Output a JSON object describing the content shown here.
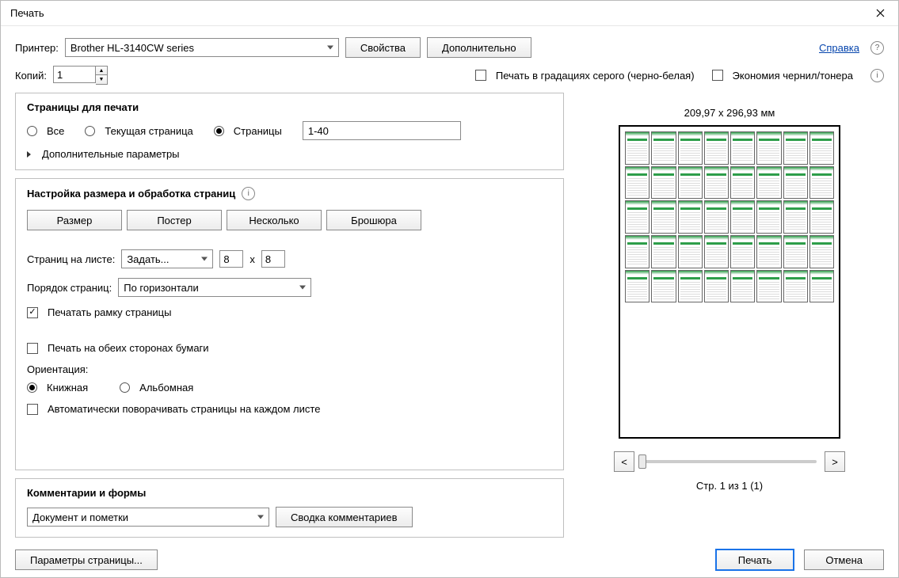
{
  "window": {
    "title": "Печать"
  },
  "top": {
    "printer_label": "Принтер:",
    "printer_value": "Brother HL-3140CW series",
    "properties_btn": "Свойства",
    "advanced_btn": "Дополнительно",
    "help_link": "Справка",
    "copies_label": "Копий:",
    "copies_value": "1",
    "grayscale_label": "Печать в градациях серого (черно-белая)",
    "save_ink_label": "Экономия чернил/тонера"
  },
  "pages_panel": {
    "title": "Страницы для печати",
    "radio_all": "Все",
    "radio_current": "Текущая страница",
    "radio_pages": "Страницы",
    "pages_value": "1-40",
    "more_opts": "Дополнительные параметры"
  },
  "handling_panel": {
    "title": "Настройка размера и обработка страниц",
    "btn_size": "Размер",
    "btn_poster": "Постер",
    "btn_multiple": "Несколько",
    "btn_booklet": "Брошюра",
    "per_sheet_label": "Страниц на листе:",
    "per_sheet_value": "Задать...",
    "per_sheet_cols": "8",
    "per_sheet_sep": "x",
    "per_sheet_rows": "8",
    "order_label": "Порядок страниц:",
    "order_value": "По горизонтали",
    "border_label": "Печатать рамку страницы",
    "duplex_label": "Печать на обеих сторонах бумаги",
    "orient_label": "Ориентация:",
    "orient_portrait": "Книжная",
    "orient_landscape": "Альбомная",
    "auto_rotate": "Автоматически поворачивать страницы на каждом листе"
  },
  "comments_panel": {
    "title": "Комментарии и формы",
    "combo_value": "Документ и пометки",
    "summary_btn": "Сводка комментариев"
  },
  "preview": {
    "dimensions": "209,97 x 296,93 мм",
    "page_of": "Стр. 1 из 1 (1)",
    "prev": "<",
    "next": ">"
  },
  "footer": {
    "page_setup": "Параметры страницы...",
    "print": "Печать",
    "cancel": "Отмена"
  }
}
